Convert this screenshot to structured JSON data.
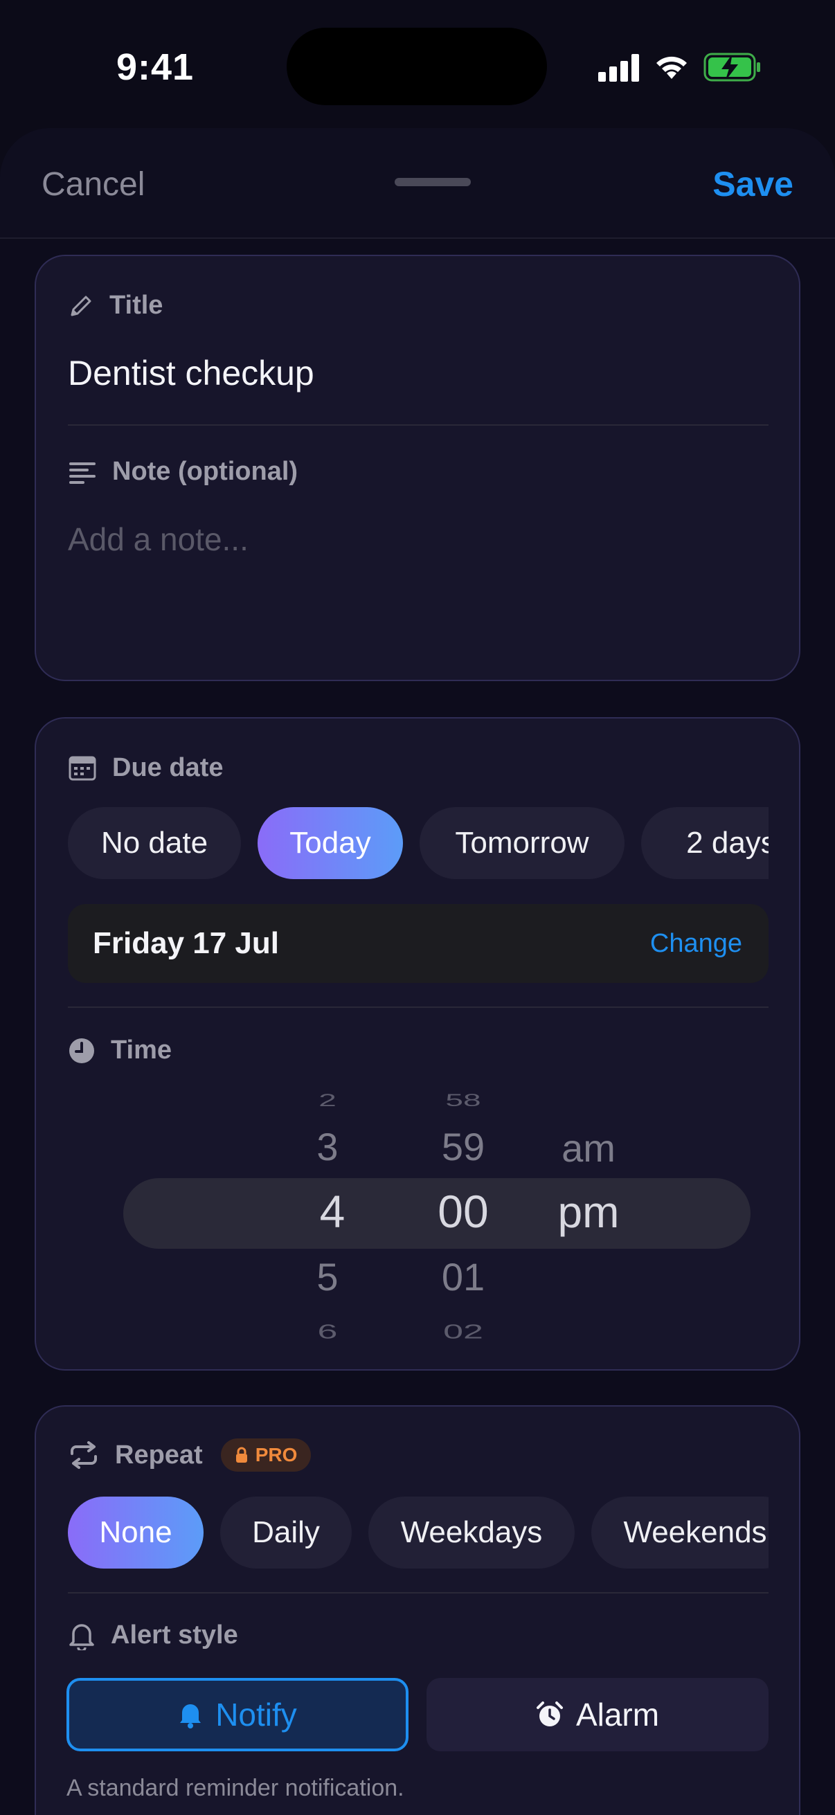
{
  "status": {
    "time": "9:41"
  },
  "header": {
    "cancel_label": "Cancel",
    "save_label": "Save"
  },
  "title_card": {
    "title_label": "Title",
    "title_value": "Dentist checkup",
    "note_label": "Note (optional)",
    "note_placeholder": "Add a note..."
  },
  "due_card": {
    "due_label": "Due date",
    "chips": [
      {
        "label": "No date",
        "active": false
      },
      {
        "label": "Today",
        "active": true
      },
      {
        "label": "Tomorrow",
        "active": false
      },
      {
        "label": "2 days",
        "active": false
      }
    ],
    "selected_date": "Friday 17 Jul",
    "change_label": "Change",
    "time_label": "Time",
    "picker": {
      "hours": [
        "2",
        "3",
        "4",
        "5",
        "6"
      ],
      "minutes": [
        "58",
        "59",
        "00",
        "01",
        "02"
      ],
      "periods": [
        "am",
        "pm"
      ],
      "selected_hour": "4",
      "selected_minute": "00",
      "selected_period": "pm"
    }
  },
  "repeat_card": {
    "repeat_label": "Repeat",
    "pro_badge": "PRO",
    "chips": [
      {
        "label": "None",
        "active": true
      },
      {
        "label": "Daily",
        "active": false
      },
      {
        "label": "Weekdays",
        "active": false
      },
      {
        "label": "Weekends",
        "active": false
      }
    ],
    "alert_label": "Alert style",
    "notify_label": "Notify",
    "alarm_label": "Alarm",
    "helper_text": "A standard reminder notification."
  },
  "colors": {
    "accent_blue": "#1e8ff0",
    "chip_gradient_start": "#8a6cf8",
    "chip_gradient_end": "#5c9cf8",
    "pro_orange": "#f08a3c"
  }
}
